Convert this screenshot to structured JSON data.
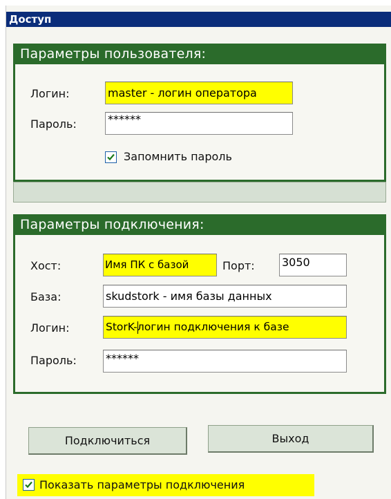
{
  "window": {
    "title": "Доступ"
  },
  "user_params": {
    "header": "Параметры пользователя:",
    "login_label": "Логин:",
    "login_value": "master - логин оператора",
    "password_label": "Пароль:",
    "password_value": "******",
    "remember_label": "Запомнить пароль",
    "remember_checked": true
  },
  "connection_params": {
    "header": "Параметры подключения:",
    "host_label": "Хост:",
    "host_value": "Имя ПК с базой",
    "port_label": "Порт:",
    "port_value": "3050",
    "db_label": "База:",
    "db_value": "skudstork - имя базы данных",
    "login_label": "Логин:",
    "login_value_before_caret": "StorK-",
    "login_value_after_caret": "логин подключения к базе",
    "password_label": "Пароль:",
    "password_value": "******"
  },
  "buttons": {
    "connect": "Подключиться",
    "exit": "Выход"
  },
  "footer": {
    "show_params_label": "Показать параметры подключения",
    "show_params_checked": true
  },
  "colors": {
    "titlebar": "#0b2d7a",
    "group_green": "#2b6b2b",
    "highlight": "#ffff00",
    "button_face": "#dbe4d8"
  },
  "icons": {
    "checkbox_check": "check-icon"
  }
}
